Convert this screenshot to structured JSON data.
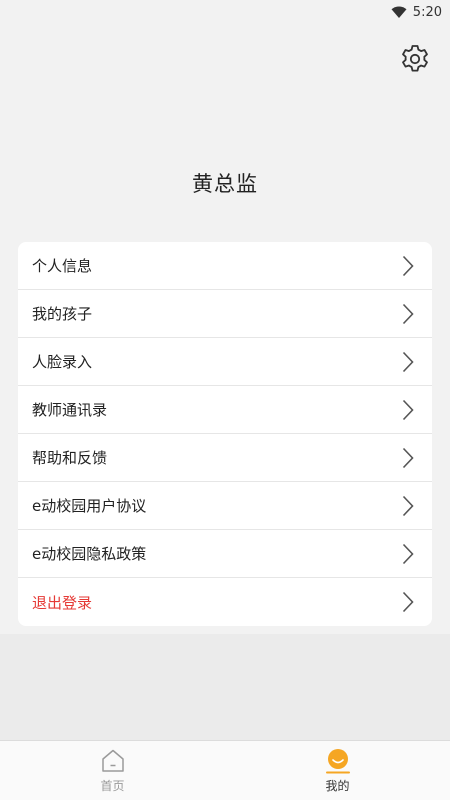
{
  "status_bar": {
    "time": "5:20"
  },
  "profile": {
    "name": "黄总监"
  },
  "menu": {
    "items": [
      {
        "label": "个人信息"
      },
      {
        "label": "我的孩子"
      },
      {
        "label": "人脸录入"
      },
      {
        "label": "教师通讯录"
      },
      {
        "label": "帮助和反馈"
      },
      {
        "label": "e动校园用户协议"
      },
      {
        "label": "e动校园隐私政策"
      },
      {
        "label": "退出登录"
      }
    ]
  },
  "tabs": [
    {
      "label": "首页"
    },
    {
      "label": "我的"
    }
  ],
  "colors": {
    "accent": "#f5a623",
    "danger": "#e53935"
  }
}
